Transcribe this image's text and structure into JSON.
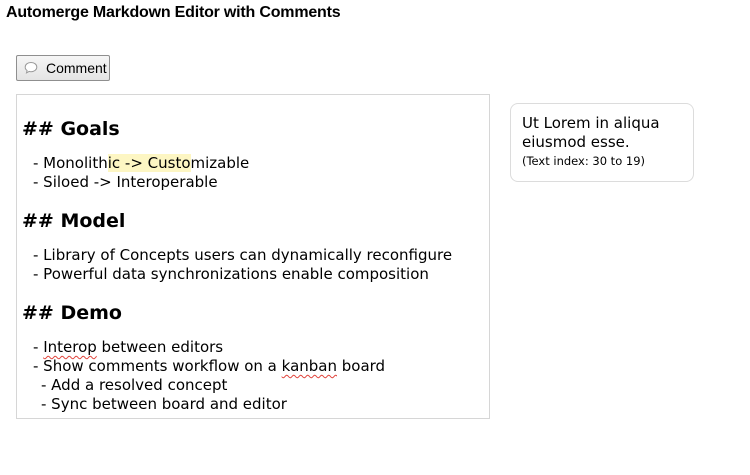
{
  "app": {
    "title": "Automerge Markdown Editor with Comments"
  },
  "toolbar": {
    "comment_icon": "speech-bubble-icon",
    "comment_label": "Comment"
  },
  "editor": {
    "heading_goals": "## Goals",
    "goals_1_pre": "- Monolith",
    "goals_1_highlight": "ic -> Custo",
    "goals_1_post": "mizable",
    "goals_2": "- Siloed -> Interoperable",
    "heading_model": "## Model",
    "model_1": "- Library of Concepts users can dynamically reconfigure",
    "model_2": "- Powerful data synchronizations enable composition",
    "heading_demo": "## Demo",
    "demo_1_dash": "- ",
    "demo_1_word": "Interop",
    "demo_1_rest": " between editors",
    "demo_2_pre": "- Show comments workflow on a ",
    "demo_2_word": "kanban",
    "demo_2_post": " board",
    "demo_3": "- Add a resolved concept",
    "demo_4": "- Sync between board and editor",
    "highlight_color": "#fdf6c3",
    "spellcheck_color": "#e0423a"
  },
  "comments": [
    {
      "text": "Ut Lorem in aliqua eiusmod esse.",
      "range_label": "(Text index: 30 to 19)"
    }
  ]
}
